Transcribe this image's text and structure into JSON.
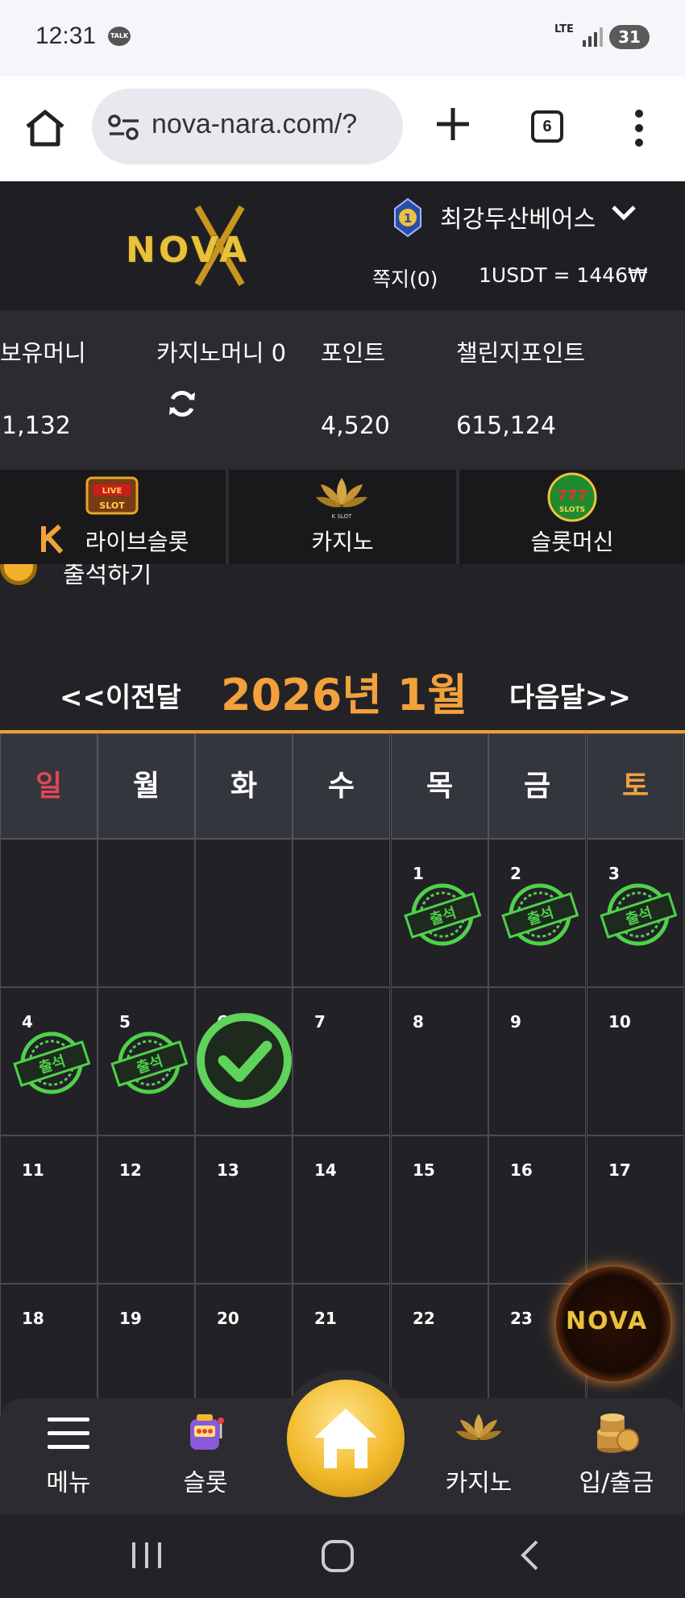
{
  "status_bar": {
    "time": "12:31",
    "talk_badge": "TALK",
    "network": "LTE",
    "battery": "31"
  },
  "browser": {
    "url": "nova-nara.com/?",
    "tab_count": "6"
  },
  "header": {
    "logo_text": "NOVA",
    "rank_badge": "1",
    "username": "최강두산베어스",
    "messages": "쪽지(0)",
    "exchange_rate": "1USDT = 1446₩"
  },
  "balances": {
    "holding_label": "보유머니",
    "holding_value": "1,132",
    "casino_label": "카지노머니 0",
    "points_label": "포인트",
    "points_value": "4,520",
    "challenge_label": "챌린지포인트",
    "challenge_value": "615,124"
  },
  "game_tabs": [
    {
      "label": "라이브슬롯",
      "icon_text": "LIVE SLOT"
    },
    {
      "label": "카지노",
      "icon_text": "K SLOT"
    },
    {
      "label": "슬롯머신",
      "icon_text": "SLOTS"
    }
  ],
  "attendance": {
    "label": "출석하기"
  },
  "calendar": {
    "prev_label": "<<이전달",
    "title": "2026년 1월",
    "next_label": "다음달>>",
    "weekdays": [
      "일",
      "월",
      "화",
      "수",
      "목",
      "금",
      "토"
    ],
    "weekday_colors": [
      "#e0455a",
      "#ffffff",
      "#ffffff",
      "#ffffff",
      "#ffffff",
      "#ffffff",
      "#f0a040"
    ],
    "stamp_text": "출석",
    "weeks": [
      [
        "",
        "",
        "",
        "",
        "1",
        "2",
        "3"
      ],
      [
        "4",
        "5",
        "6",
        "7",
        "8",
        "9",
        "10"
      ],
      [
        "11",
        "12",
        "13",
        "14",
        "15",
        "16",
        "17"
      ],
      [
        "18",
        "19",
        "20",
        "21",
        "22",
        "23",
        ""
      ]
    ],
    "stamped_days": [
      "1",
      "2",
      "3",
      "4",
      "5"
    ],
    "checked_day": "6"
  },
  "floating_logo_text": "NOVA",
  "bottom_nav": {
    "menu": "메뉴",
    "slot": "슬롯",
    "casino": "카지노",
    "deposit": "입/출금"
  },
  "colors": {
    "accent": "#f09c35",
    "stamp_green": "#4fd14a",
    "background": "#232327"
  }
}
